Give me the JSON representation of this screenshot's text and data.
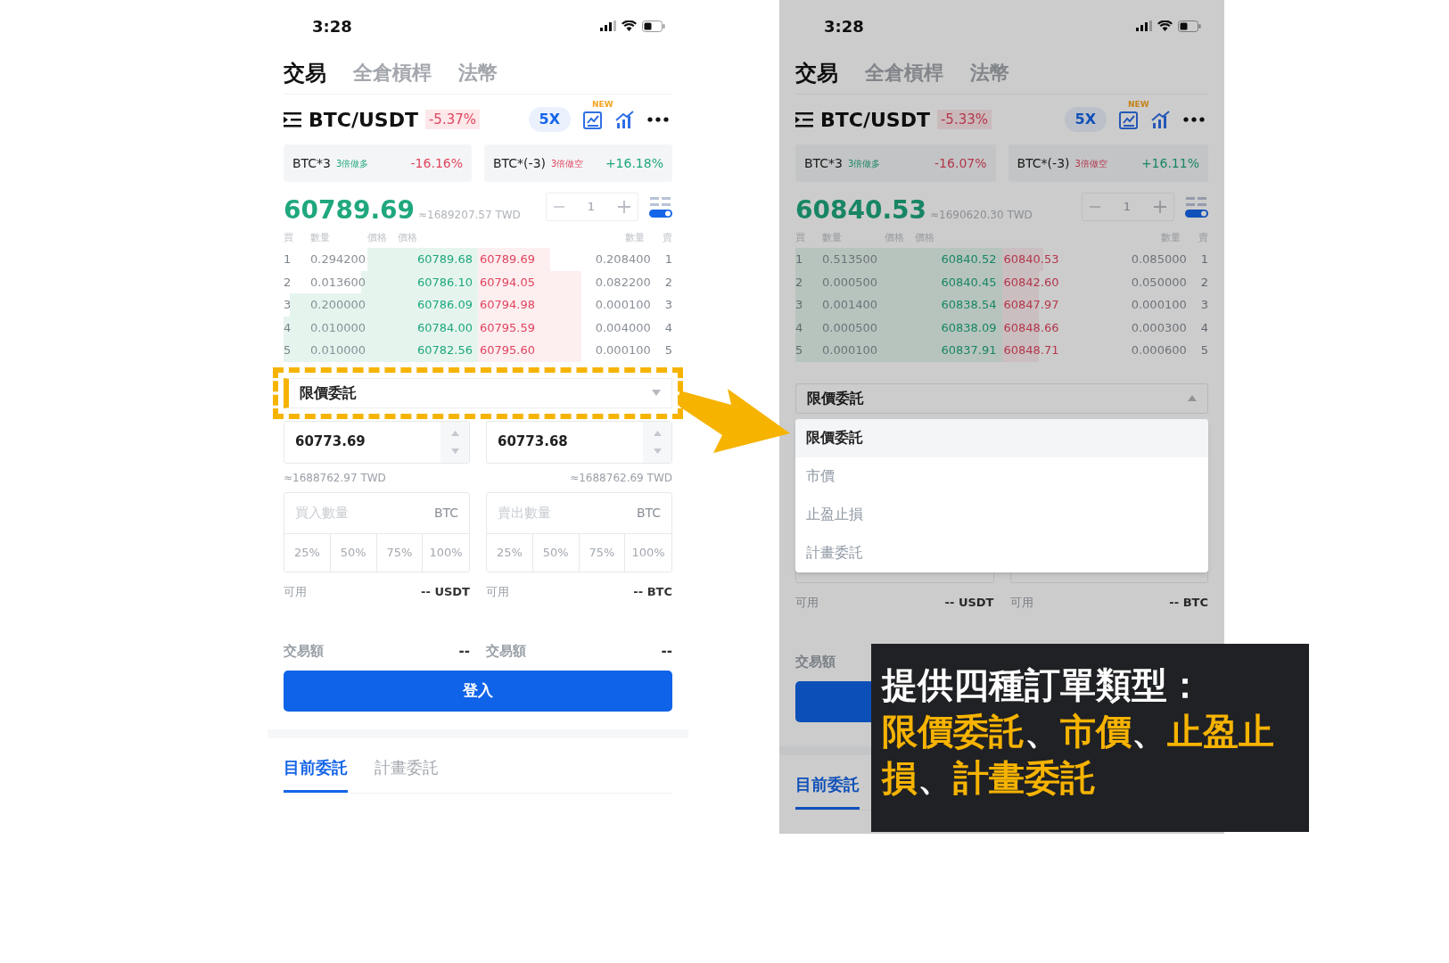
{
  "panels": [
    {
      "status_time": "3:28",
      "nav_tabs": [
        {
          "label": "交易",
          "selected": true
        },
        {
          "label": "全倉槓桿",
          "selected": false
        },
        {
          "label": "法幣",
          "selected": false
        }
      ],
      "pair": "BTC/USDT",
      "change": "-5.37%",
      "leverage": "5X",
      "new_badge": "NEW",
      "tickers": [
        {
          "name": "BTC*3",
          "tag": "3倍做多",
          "color": "#1fa77e",
          "change": {
            "text": "-16.16%",
            "color": "#e0455e"
          }
        },
        {
          "name": "BTC*(-3)",
          "tag": "3倍做空",
          "color": "#e0455e",
          "change": {
            "text": "+16.18%",
            "color": "#1fa77e"
          }
        }
      ],
      "price": "60789.69",
      "price_twd": "≈1689207.57 TWD",
      "stepper": "1",
      "book_headers": [
        "買",
        "數量",
        "價格",
        "價格",
        "數量",
        "賣"
      ],
      "book": [
        {
          "rank": "1",
          "bid_qty": "0.294200",
          "bid": "60789.68",
          "ask": "60789.69",
          "ask_qty": "0.208400",
          "ask_rank": "1",
          "bid_depth": {
            "level": 0.57
          },
          "ask_depth": {
            "level": 0.37
          }
        },
        {
          "rank": "2",
          "bid_qty": "0.013600",
          "bid": "60786.10",
          "ask": "60794.05",
          "ask_qty": "0.082200",
          "ask_rank": "2",
          "bid_depth": {
            "level": 0.6
          },
          "ask_depth": {
            "level": 0.53
          }
        },
        {
          "rank": "3",
          "bid_qty": "0.200000",
          "bid": "60786.09",
          "ask": "60794.98",
          "ask_qty": "0.000100",
          "ask_rank": "3",
          "bid_depth": {
            "level": 0.97
          },
          "ask_depth": {
            "level": 0.53
          }
        },
        {
          "rank": "4",
          "bid_qty": "0.010000",
          "bid": "60784.00",
          "ask": "60795.59",
          "ask_qty": "0.004000",
          "ask_rank": "4",
          "bid_depth": {
            "level": 1
          },
          "ask_depth": {
            "level": 0.53
          }
        },
        {
          "rank": "5",
          "bid_qty": "0.010000",
          "bid": "60782.56",
          "ask": "60795.60",
          "ask_qty": "0.000100",
          "ask_rank": "5",
          "bid_depth": {
            "level": 1
          },
          "ask_depth": {
            "level": 0.53
          }
        }
      ],
      "order_type": "限價委託",
      "highlighted": true,
      "expanded": false,
      "form": {
        "buy_price": "60773.69",
        "sell_price": "60773.68",
        "buy_twd": "≈1688762.97 TWD",
        "sell_twd": "≈1688762.69 TWD",
        "qty": [
          {
            "placeholder": "買入數量",
            "unit": "BTC",
            "percents": [
              "25%",
              "50%",
              "75%",
              "100%"
            ]
          },
          {
            "placeholder": "賣出數量",
            "unit": "BTC",
            "percents": [
              "25%",
              "50%",
              "75%",
              "100%"
            ]
          }
        ]
      },
      "available": [
        {
          "label": "可用",
          "value": "-- USDT"
        },
        {
          "label": "可用",
          "value": "-- BTC"
        }
      ],
      "amount": [
        {
          "label": "交易額",
          "value": "--"
        },
        {
          "label": "交易額",
          "value": "--"
        }
      ],
      "login": "登入",
      "order_tabs": [
        {
          "label": "目前委託",
          "selected": true
        },
        {
          "label": "計畫委託",
          "selected": false
        }
      ]
    },
    {
      "status_time": "3:28",
      "nav_tabs": [
        {
          "label": "交易",
          "selected": true
        },
        {
          "label": "全倉槓桿",
          "selected": false
        },
        {
          "label": "法幣",
          "selected": false
        }
      ],
      "pair": "BTC/USDT",
      "change": "-5.33%",
      "leverage": "5X",
      "new_badge": "NEW",
      "tickers": [
        {
          "name": "BTC*3",
          "tag": "3倍做多",
          "color": "#198665",
          "change": {
            "text": "-16.07%",
            "color": "#b3374b"
          }
        },
        {
          "name": "BTC*(-3)",
          "tag": "3倍做空",
          "color": "#b3374b",
          "change": {
            "text": "+16.11%",
            "color": "#198665"
          }
        }
      ],
      "price": "60840.53",
      "price_twd": "≈1690620.30 TWD",
      "stepper": "1",
      "book_headers": [
        "買",
        "數量",
        "價格",
        "價格",
        "數量",
        "賣"
      ],
      "book": [
        {
          "rank": "1",
          "bid_qty": "0.513500",
          "bid": "60840.52",
          "ask": "60840.53",
          "ask_qty": "0.085000",
          "ask_rank": "1",
          "bid_depth": {
            "level": 1
          },
          "ask_depth": {
            "level": 0.2
          }
        },
        {
          "rank": "2",
          "bid_qty": "0.000500",
          "bid": "60840.45",
          "ask": "60842.60",
          "ask_qty": "0.050000",
          "ask_rank": "2",
          "bid_depth": {
            "level": 1
          },
          "ask_depth": {
            "level": 0.18
          }
        },
        {
          "rank": "3",
          "bid_qty": "0.001400",
          "bid": "60838.54",
          "ask": "60847.97",
          "ask_qty": "0.000100",
          "ask_rank": "3",
          "bid_depth": {
            "level": 1
          },
          "ask_depth": {
            "level": 0.18
          }
        },
        {
          "rank": "4",
          "bid_qty": "0.000500",
          "bid": "60838.09",
          "ask": "60848.66",
          "ask_qty": "0.000300",
          "ask_rank": "4",
          "bid_depth": {
            "level": 1
          },
          "ask_depth": {
            "level": 0.18
          }
        },
        {
          "rank": "5",
          "bid_qty": "0.000100",
          "bid": "60837.91",
          "ask": "60848.71",
          "ask_qty": "0.000600",
          "ask_rank": "5",
          "bid_depth": {
            "level": 1
          },
          "ask_depth": {
            "level": 0.18
          }
        }
      ],
      "order_type": "限價委託",
      "highlighted": false,
      "expanded": true,
      "menu": [
        {
          "label": "限價委託",
          "selected": true
        },
        {
          "label": "市價",
          "selected": false
        },
        {
          "label": "止盈止損",
          "selected": false
        },
        {
          "label": "計畫委託",
          "selected": false
        }
      ],
      "available": [
        {
          "label": "可用",
          "value": "-- USDT"
        },
        {
          "label": "可用",
          "value": "-- BTC"
        }
      ],
      "amount": [
        {
          "label": "交易額"
        }
      ],
      "order_tabs": [
        {
          "label": "目前委託",
          "selected": true
        }
      ]
    }
  ],
  "callout": {
    "title": "提供四種訂單類型：",
    "items": [
      "限價委託",
      "市價",
      "止盈止損",
      "計畫委託"
    ],
    "separator": "、"
  }
}
